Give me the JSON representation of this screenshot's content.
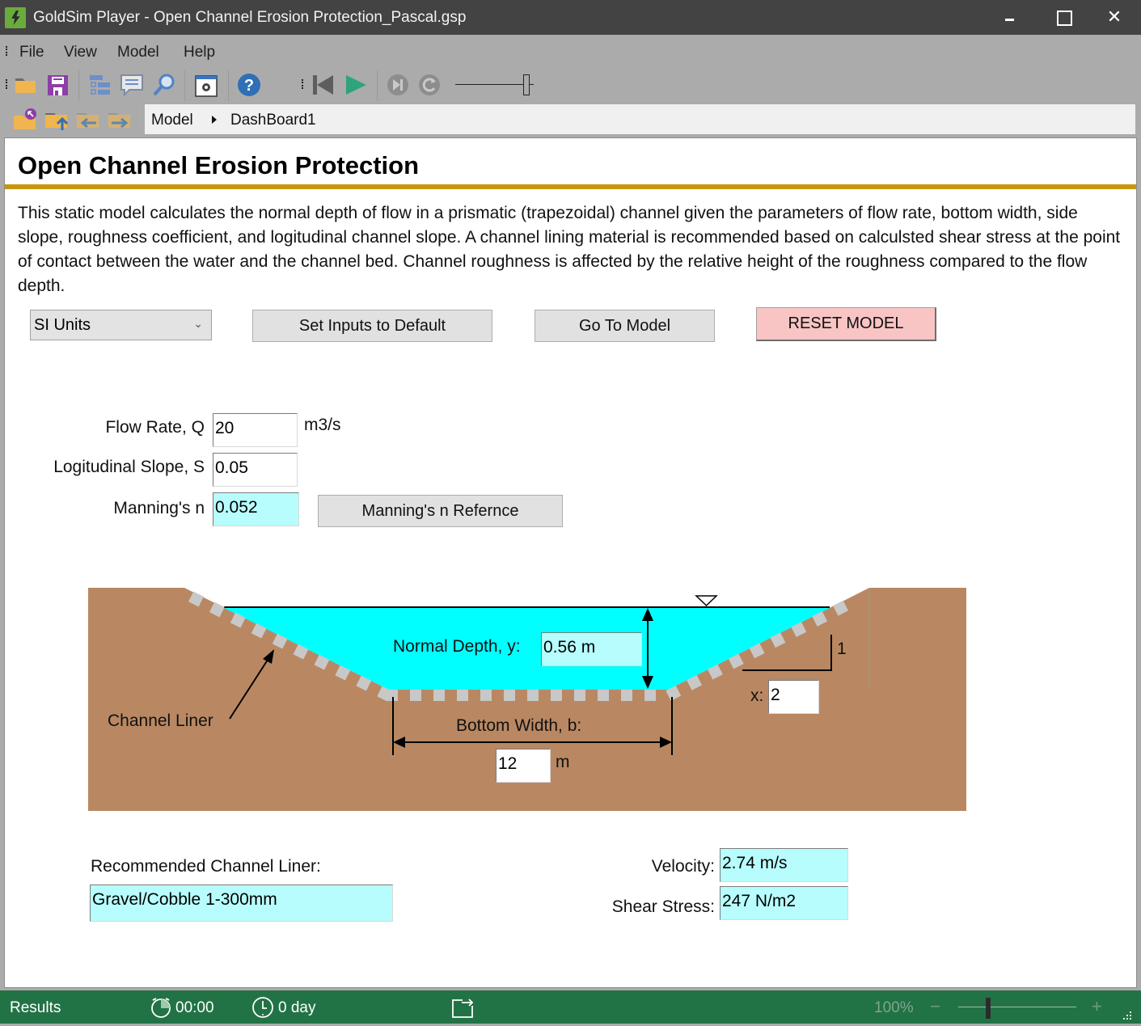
{
  "window": {
    "title": "GoldSim Player - Open Channel Erosion Protection_Pascal.gsp",
    "controls": {
      "minimize": "minimize",
      "maximize": "maximize",
      "close": "✕"
    }
  },
  "menu": [
    "File",
    "View",
    "Model",
    "Help"
  ],
  "toolbar": {
    "icons": [
      "open-folder-icon",
      "save-icon",
      "browser-tree-icon",
      "notes-icon",
      "find-icon",
      "properties-icon",
      "help-icon",
      "rewind-icon",
      "play-icon",
      "step-icon",
      "reset-run-icon",
      "speed-slider"
    ],
    "nav_icons": [
      "dashboard-home-icon",
      "folder-up-icon",
      "back-icon",
      "forward-icon"
    ]
  },
  "breadcrumb": [
    "Model",
    "DashBoard1"
  ],
  "page": {
    "title": "Open Channel Erosion Protection",
    "description": "This static model calculates the normal depth of flow in a prismatic (trapezoidal) channel given the parameters of flow rate, bottom width, side slope, roughness coefficient, and logitudinal channel slope. A channel lining material is recommended based on calculsted shear stress at the point of contact between the water and the channel bed. Channel roughness is affected by the relative height of the roughness compared to the flow depth."
  },
  "controls": {
    "units_select": {
      "value": "SI Units"
    },
    "set_default_label": "Set Inputs to Default",
    "go_to_model_label": "Go To Model",
    "reset_label": "RESET MODEL",
    "mannings_ref_label": "Manning's n Refernce"
  },
  "inputs": {
    "flow_rate": {
      "label": "Flow Rate, Q",
      "value": "20",
      "unit": "m3/s"
    },
    "slope": {
      "label": "Logitudinal Slope, S",
      "value": "0.05"
    },
    "mannings_n": {
      "label": "Manning's n",
      "value": "0.052"
    }
  },
  "diagram": {
    "normal_depth_label": "Normal Depth, y:",
    "normal_depth_value": "0.56 m",
    "channel_liner_label": "Channel Liner",
    "bottom_width_label": "Bottom Width, b:",
    "bottom_width_value": "12",
    "bottom_width_unit": "m",
    "side_slope_rise": "1",
    "side_slope_label": "x:",
    "side_slope_value": "2",
    "colors": {
      "soil": "#b98862",
      "water": "#00ffff",
      "liner": "#c8c8c8"
    }
  },
  "results": {
    "liner_label": "Recommended Channel Liner:",
    "liner_value": "Gravel/Cobble 1-300mm",
    "velocity_label": "Velocity:",
    "velocity_value": "2.74 m/s",
    "shear_label": "Shear Stress:",
    "shear_value": "247 N/m2"
  },
  "statusbar": {
    "mode": "Results",
    "elapsed": "00:00",
    "sim_time": "0 day",
    "zoom": "100%",
    "zoom_minus": "−",
    "zoom_plus": "+"
  }
}
